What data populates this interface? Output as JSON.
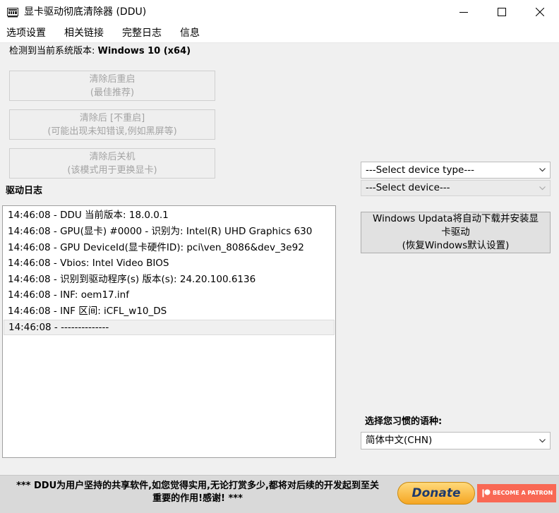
{
  "window": {
    "title": "显卡驱动彻底清除器 (DDU)",
    "icon": "ddu-app-icon",
    "controls": [
      "minimize-icon",
      "maximize-icon",
      "close-icon"
    ]
  },
  "menu": {
    "items": [
      {
        "label": "选项设置"
      },
      {
        "label": "相关链接"
      },
      {
        "label": "完整日志"
      },
      {
        "label": "信息"
      }
    ]
  },
  "system": {
    "prefix": "检测到当前系统版本: ",
    "version": "Windows 10 (x64)"
  },
  "actions": {
    "clean_restart": {
      "line1": "清除后重启",
      "line2": "(最佳推荐)",
      "enabled": false
    },
    "clean_no_restart": {
      "line1": "清除后 [不重启]",
      "line2": "(可能出现未知错误,例如黑屏等)",
      "enabled": false
    },
    "clean_shutdown": {
      "line1": "清除后关机",
      "line2": "(该模式用于更换显卡)",
      "enabled": false
    }
  },
  "log": {
    "label": "驱动日志",
    "entries": [
      "14:46:08 - DDU 当前版本: 18.0.0.1",
      "14:46:08 - GPU(显卡) #0000 - 识别为: Intel(R) UHD Graphics 630",
      "14:46:08 - GPU DeviceId(显卡硬件ID): pci\\ven_8086&dev_3e92",
      "14:46:08 - Vbios: Intel Video BIOS",
      "14:46:08 - 识别到驱动程序(s) 版本(s): 24.20.100.6136",
      "14:46:08 - INF: oem17.inf",
      "14:46:08 - INF 区间: iCFL_w10_DS",
      "14:46:08 - --------------"
    ],
    "selected_index": 7
  },
  "device": {
    "type_select": "---Select device type---",
    "device_select": "---Select device---"
  },
  "windows_update": {
    "line1": "Windows Updata将自动下载并安装显",
    "line2": "卡驱动",
    "line3": "(恢复Windows默认设置)"
  },
  "language": {
    "label": "选择您习惯的语种:",
    "value": "简体中文(CHN)"
  },
  "footer": {
    "line1": "*** DDU为用户坚持的共享软件,如您觉得实用,无论打赏多少,都将对后续的开发起到至关",
    "line2": "重要的作用!感谢! ***",
    "donate_label": "Donate",
    "patron_label": "BECOME A PATRON"
  },
  "colors": {
    "patron_red": "#f96854",
    "donate_gold": "#f5a623",
    "donate_text": "#1e3a6d"
  }
}
